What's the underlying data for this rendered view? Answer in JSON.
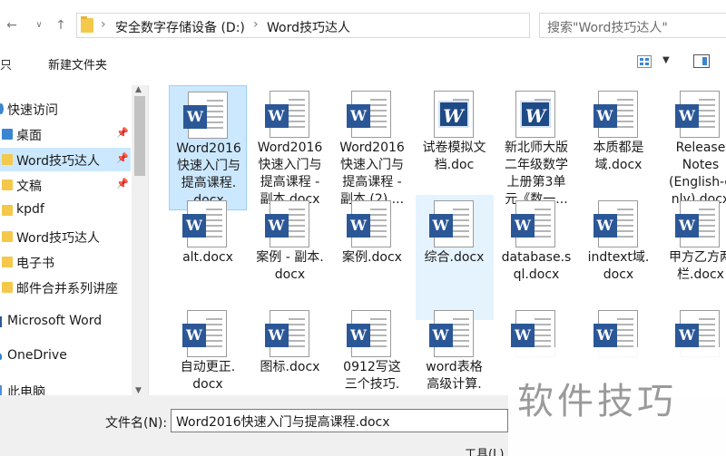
{
  "address": {
    "crumbs": [
      "安全数字存储设备 (D:)",
      "Word技巧达人"
    ],
    "search_placeholder": "搜索\"Word技巧达人\""
  },
  "toolbar": {
    "left_label": "只",
    "new_folder": "新建文件夹"
  },
  "sidebar": {
    "items": [
      {
        "label": "快速访问",
        "icon": "star-icon"
      },
      {
        "label": "桌面",
        "icon": "desktop-icon",
        "pinned": true
      },
      {
        "label": "Word技巧达人",
        "icon": "folder-icon",
        "pinned": true,
        "selected": true
      },
      {
        "label": "文稿",
        "icon": "folder-icon",
        "pinned": true
      },
      {
        "label": "kpdf",
        "icon": "folder-icon"
      },
      {
        "label": "Word技巧达人",
        "icon": "folder-icon"
      },
      {
        "label": "电子书",
        "icon": "folder-icon"
      },
      {
        "label": "邮件合并系列讲座",
        "icon": "folder-icon"
      },
      {
        "label": "Microsoft Word",
        "icon": "word-icon"
      },
      {
        "label": "OneDrive",
        "icon": "cloud-icon"
      },
      {
        "label": "此电脑",
        "icon": "computer-icon"
      }
    ]
  },
  "files": [
    {
      "name": "Word2016快速入门与提高课程.docx",
      "lines": [
        "Word2016",
        "快速入门与",
        "提高课程.",
        "docx"
      ],
      "selected": true
    },
    {
      "name": "Word2016快速入门与提高课程 - 副本.docx",
      "lines": [
        "Word2016",
        "快速入门与",
        "提高课程 -",
        "副本.docx"
      ]
    },
    {
      "name": "Word2016快速入门与提高课程 - 副本 (2)....",
      "lines": [
        "Word2016",
        "快速入门与",
        "提高课程 -",
        "副本 (2)...."
      ]
    },
    {
      "name": "试卷模拟文档.doc",
      "lines": [
        "试卷模拟文",
        "档.doc"
      ],
      "old": true
    },
    {
      "name": "新北师大版二年级数学上册第3单元《数一...",
      "lines": [
        "新北师大版",
        "二年级数学",
        "上册第3单",
        "元《数一..."
      ],
      "old": true
    },
    {
      "name": "本质都是域.docx",
      "lines": [
        "本质都是",
        "域.docx"
      ]
    },
    {
      "name": "Release Notes (English-only).docx",
      "lines": [
        "Release",
        "Notes",
        "(English-o",
        "nly).docx"
      ]
    },
    {
      "name": "alt.docx",
      "lines": [
        "alt.docx"
      ]
    },
    {
      "name": "案例 - 副本.docx",
      "lines": [
        "案例 - 副本.",
        "docx"
      ]
    },
    {
      "name": "案例.docx",
      "lines": [
        "案例.docx"
      ]
    },
    {
      "name": "综合.docx",
      "lines": [
        "综合.docx"
      ],
      "hover": true
    },
    {
      "name": "database.sql.docx",
      "lines": [
        "database.s",
        "ql.docx"
      ]
    },
    {
      "name": "indtext域.docx",
      "lines": [
        "indtext域.",
        "docx"
      ]
    },
    {
      "name": "甲方乙方两栏.docx",
      "lines": [
        "甲方乙方两",
        "栏.docx"
      ]
    },
    {
      "name": "自动更正.docx",
      "lines": [
        "自动更正.",
        "docx"
      ]
    },
    {
      "name": "图标.docx",
      "lines": [
        "图标.docx"
      ]
    },
    {
      "name": "0912写这三个技巧.",
      "lines": [
        "0912写这",
        "三个技巧."
      ]
    },
    {
      "name": "word表格高级计算.",
      "lines": [
        "word表格",
        "高级计算."
      ]
    },
    {
      "name": "",
      "lines": []
    },
    {
      "name": "",
      "lines": []
    },
    {
      "name": "",
      "lines": []
    }
  ],
  "bottom": {
    "filename_label": "文件名(N):",
    "filename_value": "Word2016快速入门与提高课程.docx",
    "tools_label": "工具(L)"
  },
  "watermark": "软件技巧"
}
